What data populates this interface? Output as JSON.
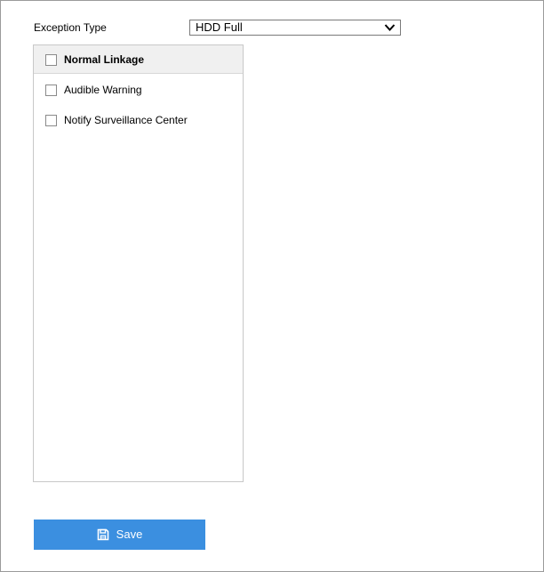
{
  "form": {
    "exception_type_label": "Exception Type",
    "exception_type_value": "HDD Full"
  },
  "linkage": {
    "header_label": "Normal Linkage",
    "items": [
      {
        "label": "Audible Warning"
      },
      {
        "label": "Notify Surveillance Center"
      }
    ]
  },
  "actions": {
    "save_label": "Save"
  },
  "colors": {
    "accent": "#3b8fe0",
    "panel_header_bg": "#f0f0f0",
    "border": "#c8c8c8"
  },
  "icons": {
    "dropdown": "chevron-down-icon",
    "save": "floppy-disk-icon"
  }
}
